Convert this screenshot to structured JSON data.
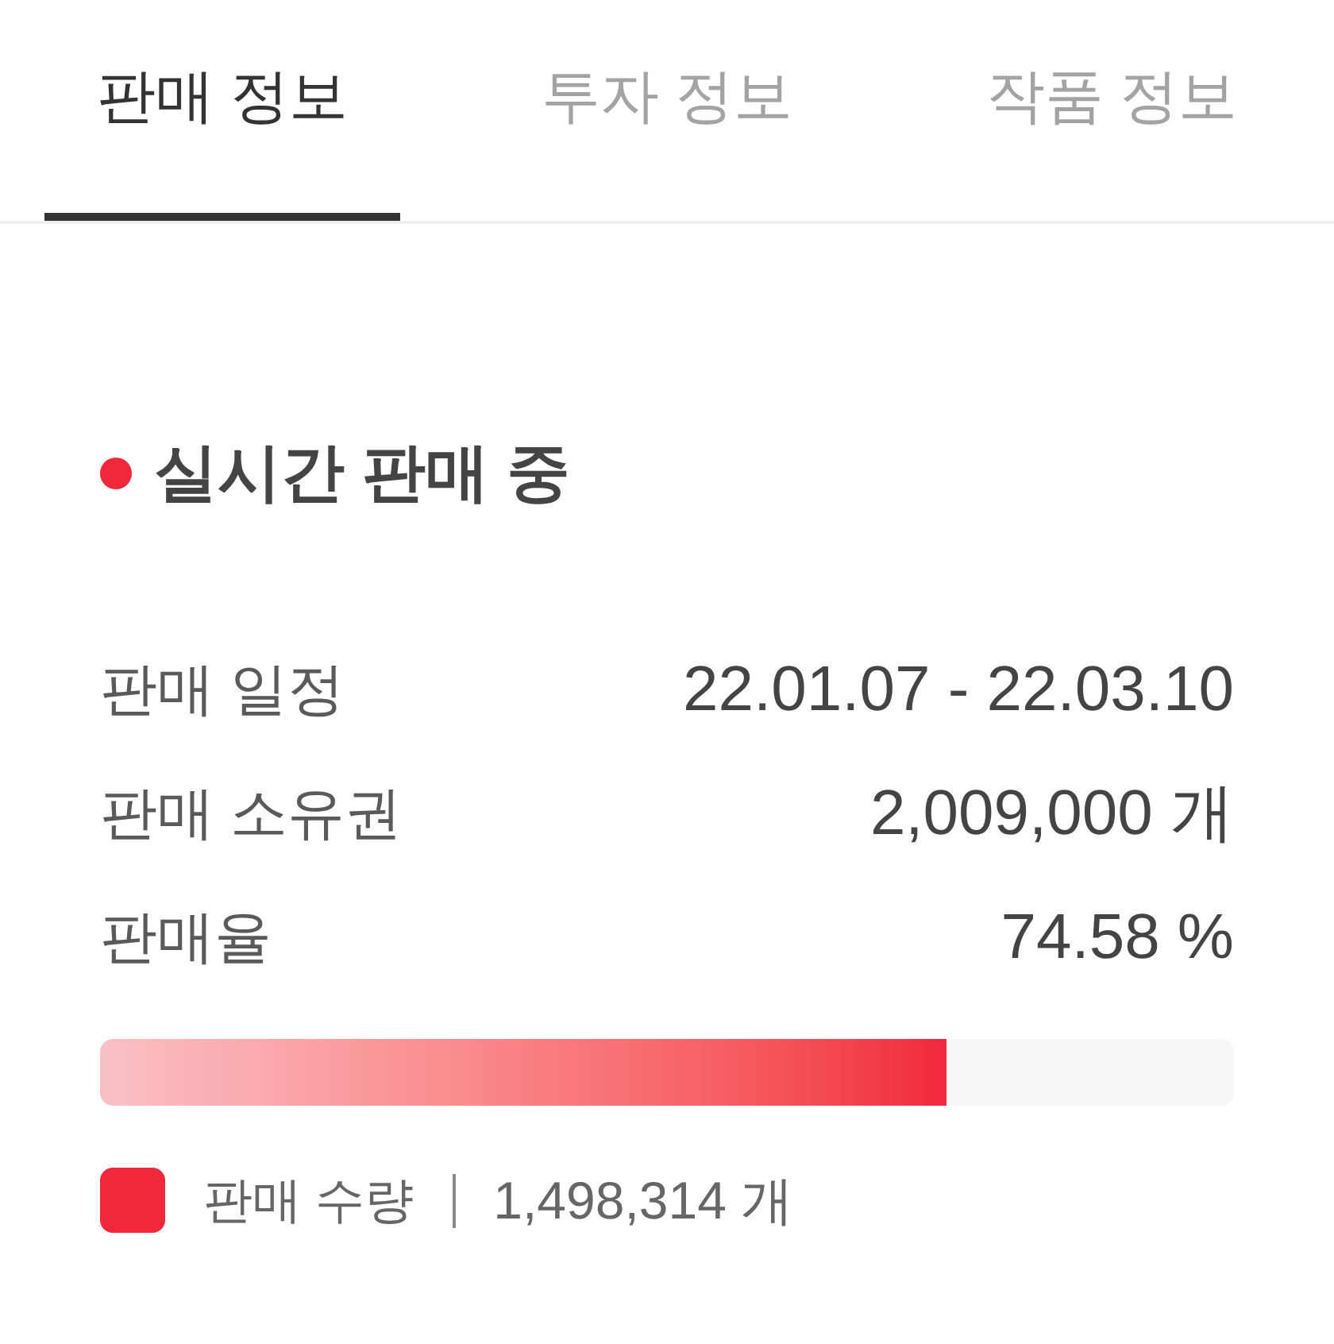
{
  "tabs": [
    {
      "label": "판매 정보",
      "selected": true
    },
    {
      "label": "투자 정보",
      "selected": false
    },
    {
      "label": "작품 정보",
      "selected": false
    }
  ],
  "status": {
    "label": "실시간 판매 중"
  },
  "details": [
    {
      "label": "판매 일정",
      "value": "22.01.07 - 22.03.10"
    },
    {
      "label": "판매 소유권",
      "value": "2,009,000 개"
    },
    {
      "label": "판매율",
      "value": "74.58 %"
    }
  ],
  "progress": {
    "level": 0.7458
  },
  "legend": {
    "label": "판매 수량",
    "value": "1,498,314 개"
  }
}
